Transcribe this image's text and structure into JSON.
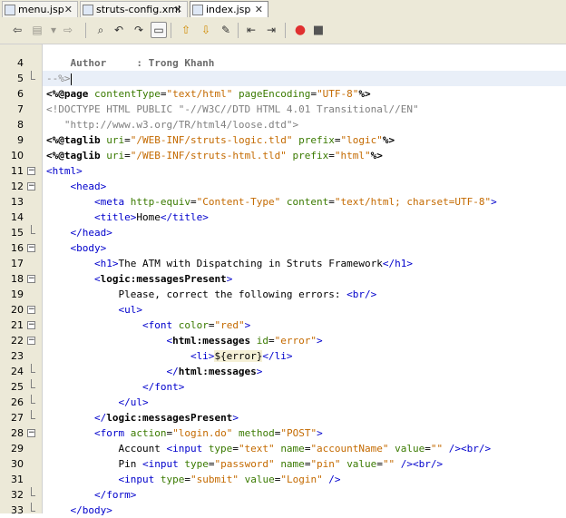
{
  "tabs": [
    {
      "label": "menu.jsp",
      "active": false
    },
    {
      "label": "struts-config.xml",
      "active": false
    },
    {
      "label": "index.jsp",
      "active": true
    }
  ],
  "toolbar_icons": [
    "back-icon",
    "history-icon",
    "forward-icon",
    "find-icon",
    "find-prev-icon",
    "find-next-icon",
    "toggle-highlight-icon",
    "shift-left-icon",
    "shift-right-icon",
    "comment-icon",
    "previous-bookmark-icon",
    "next-bookmark-icon",
    "record-macro-icon",
    "stop-macro-icon"
  ],
  "lines": [
    {
      "n": "4",
      "fold": "none",
      "parts": [
        [
          "c-gb",
          "    Author     : Trong Khanh"
        ]
      ]
    },
    {
      "n": "5",
      "fold": "end",
      "parts": [
        [
          "c-gc",
          "--%>"
        ]
      ],
      "highlight": true,
      "caret": true
    },
    {
      "n": "6",
      "fold": "none",
      "parts": [
        [
          "c-dir",
          "<%@page "
        ],
        [
          "c-attr",
          "contentType"
        ],
        [
          "c-el",
          "="
        ],
        [
          "c-val",
          "\"text/html\""
        ],
        [
          "c-el",
          " "
        ],
        [
          "c-attr",
          "pageEncoding"
        ],
        [
          "c-el",
          "="
        ],
        [
          "c-val",
          "\"UTF-8\""
        ],
        [
          "c-dir",
          "%>"
        ]
      ]
    },
    {
      "n": "7",
      "fold": "none",
      "parts": [
        [
          "c-grey",
          "<!DOCTYPE HTML PUBLIC \"-//W3C//DTD HTML 4.01 Transitional//EN\""
        ]
      ]
    },
    {
      "n": "8",
      "fold": "none",
      "parts": [
        [
          "c-grey",
          "   \"http://www.w3.org/TR/html4/loose.dtd\">"
        ]
      ]
    },
    {
      "n": "9",
      "fold": "none",
      "parts": [
        [
          "c-dir",
          "<%@taglib "
        ],
        [
          "c-attr",
          "uri"
        ],
        [
          "c-el",
          "="
        ],
        [
          "c-val",
          "\"/WEB-INF/struts-logic.tld\""
        ],
        [
          "c-el",
          " "
        ],
        [
          "c-attr",
          "prefix"
        ],
        [
          "c-el",
          "="
        ],
        [
          "c-val",
          "\"logic\""
        ],
        [
          "c-dir",
          "%>"
        ]
      ]
    },
    {
      "n": "10",
      "fold": "none",
      "parts": [
        [
          "c-dir",
          "<%@taglib "
        ],
        [
          "c-attr",
          "uri"
        ],
        [
          "c-el",
          "="
        ],
        [
          "c-val",
          "\"/WEB-INF/struts-html.tld\""
        ],
        [
          "c-el",
          " "
        ],
        [
          "c-attr",
          "prefix"
        ],
        [
          "c-el",
          "="
        ],
        [
          "c-val",
          "\"html\""
        ],
        [
          "c-dir",
          "%>"
        ]
      ]
    },
    {
      "n": "11",
      "fold": "open",
      "parts": [
        [
          "c-tag",
          "<html>"
        ]
      ]
    },
    {
      "n": "12",
      "fold": "open",
      "parts": [
        [
          "c-tag",
          "    <head>"
        ]
      ]
    },
    {
      "n": "13",
      "fold": "none",
      "parts": [
        [
          "c-tag",
          "        <meta "
        ],
        [
          "c-attr",
          "http-equiv"
        ],
        [
          "c-el",
          "="
        ],
        [
          "c-val",
          "\"Content-Type\""
        ],
        [
          "c-el",
          " "
        ],
        [
          "c-attr",
          "content"
        ],
        [
          "c-el",
          "="
        ],
        [
          "c-val",
          "\"text/html; charset=UTF-8\""
        ],
        [
          "c-tag",
          ">"
        ]
      ]
    },
    {
      "n": "14",
      "fold": "none",
      "parts": [
        [
          "c-tag",
          "        <title>"
        ],
        [
          "c-el",
          "Home"
        ],
        [
          "c-tag",
          "</title>"
        ]
      ]
    },
    {
      "n": "15",
      "fold": "end",
      "parts": [
        [
          "c-tag",
          "    </head>"
        ]
      ]
    },
    {
      "n": "16",
      "fold": "open",
      "parts": [
        [
          "c-tag",
          "    <body>"
        ]
      ]
    },
    {
      "n": "17",
      "fold": "none",
      "parts": [
        [
          "c-tag",
          "        <h1>"
        ],
        [
          "c-el",
          "The ATM with Dispatching in Struts Framework"
        ],
        [
          "c-tag",
          "</h1>"
        ]
      ]
    },
    {
      "n": "18",
      "fold": "open",
      "parts": [
        [
          "c-tag",
          "        <"
        ],
        [
          "c-jtag",
          "logic:messagesPresent"
        ],
        [
          "c-tag",
          ">"
        ]
      ]
    },
    {
      "n": "19",
      "fold": "none",
      "parts": [
        [
          "c-el",
          "            Please, correct the following errors: "
        ],
        [
          "c-tag",
          "<br/>"
        ]
      ]
    },
    {
      "n": "20",
      "fold": "open",
      "parts": [
        [
          "c-tag",
          "            <ul>"
        ]
      ]
    },
    {
      "n": "21",
      "fold": "open",
      "parts": [
        [
          "c-tag",
          "                <font "
        ],
        [
          "c-attr",
          "color"
        ],
        [
          "c-el",
          "="
        ],
        [
          "c-val",
          "\"red\""
        ],
        [
          "c-tag",
          ">"
        ]
      ]
    },
    {
      "n": "22",
      "fold": "open",
      "parts": [
        [
          "c-tag",
          "                    <"
        ],
        [
          "c-jtag",
          "html:messages"
        ],
        [
          "c-el",
          " "
        ],
        [
          "c-attr",
          "id"
        ],
        [
          "c-el",
          "="
        ],
        [
          "c-val",
          "\"error\""
        ],
        [
          "c-tag",
          ">"
        ]
      ]
    },
    {
      "n": "23",
      "fold": "none",
      "parts": [
        [
          "c-tag",
          "                        <li>"
        ],
        [
          "c-expr",
          "${error}"
        ],
        [
          "c-tag",
          "</li>"
        ]
      ]
    },
    {
      "n": "24",
      "fold": "end",
      "parts": [
        [
          "c-tag",
          "                    </"
        ],
        [
          "c-jtag",
          "html:messages"
        ],
        [
          "c-tag",
          ">"
        ]
      ]
    },
    {
      "n": "25",
      "fold": "end",
      "parts": [
        [
          "c-tag",
          "                </font>"
        ]
      ]
    },
    {
      "n": "26",
      "fold": "end",
      "parts": [
        [
          "c-tag",
          "            </ul>"
        ]
      ]
    },
    {
      "n": "27",
      "fold": "end",
      "parts": [
        [
          "c-tag",
          "        </"
        ],
        [
          "c-jtag",
          "logic:messagesPresent"
        ],
        [
          "c-tag",
          ">"
        ]
      ]
    },
    {
      "n": "28",
      "fold": "open",
      "parts": [
        [
          "c-tag",
          "        <form "
        ],
        [
          "c-attr",
          "action"
        ],
        [
          "c-el",
          "="
        ],
        [
          "c-val",
          "\"login.do\""
        ],
        [
          "c-el",
          " "
        ],
        [
          "c-attr",
          "method"
        ],
        [
          "c-el",
          "="
        ],
        [
          "c-val",
          "\"POST\""
        ],
        [
          "c-tag",
          ">"
        ]
      ]
    },
    {
      "n": "29",
      "fold": "none",
      "parts": [
        [
          "c-el",
          "            Account "
        ],
        [
          "c-tag",
          "<input "
        ],
        [
          "c-attr",
          "type"
        ],
        [
          "c-el",
          "="
        ],
        [
          "c-val",
          "\"text\""
        ],
        [
          "c-el",
          " "
        ],
        [
          "c-attr",
          "name"
        ],
        [
          "c-el",
          "="
        ],
        [
          "c-val",
          "\"accountName\""
        ],
        [
          "c-el",
          " "
        ],
        [
          "c-attr",
          "value"
        ],
        [
          "c-el",
          "="
        ],
        [
          "c-val",
          "\"\""
        ],
        [
          "c-tag",
          " /><br/>"
        ]
      ]
    },
    {
      "n": "30",
      "fold": "none",
      "parts": [
        [
          "c-el",
          "            Pin "
        ],
        [
          "c-tag",
          "<input "
        ],
        [
          "c-attr",
          "type"
        ],
        [
          "c-el",
          "="
        ],
        [
          "c-val",
          "\"password\""
        ],
        [
          "c-el",
          " "
        ],
        [
          "c-attr",
          "name"
        ],
        [
          "c-el",
          "="
        ],
        [
          "c-val",
          "\"pin\""
        ],
        [
          "c-el",
          " "
        ],
        [
          "c-attr",
          "value"
        ],
        [
          "c-el",
          "="
        ],
        [
          "c-val",
          "\"\""
        ],
        [
          "c-tag",
          " /><br/>"
        ]
      ]
    },
    {
      "n": "31",
      "fold": "none",
      "parts": [
        [
          "c-tag",
          "            <input "
        ],
        [
          "c-attr",
          "type"
        ],
        [
          "c-el",
          "="
        ],
        [
          "c-val",
          "\"submit\""
        ],
        [
          "c-el",
          " "
        ],
        [
          "c-attr",
          "value"
        ],
        [
          "c-el",
          "="
        ],
        [
          "c-val",
          "\"Login\""
        ],
        [
          "c-tag",
          " />"
        ]
      ]
    },
    {
      "n": "32",
      "fold": "end",
      "parts": [
        [
          "c-tag",
          "        </form>"
        ]
      ]
    },
    {
      "n": "33",
      "fold": "end",
      "parts": [
        [
          "c-tag",
          "    </body>"
        ]
      ]
    }
  ]
}
